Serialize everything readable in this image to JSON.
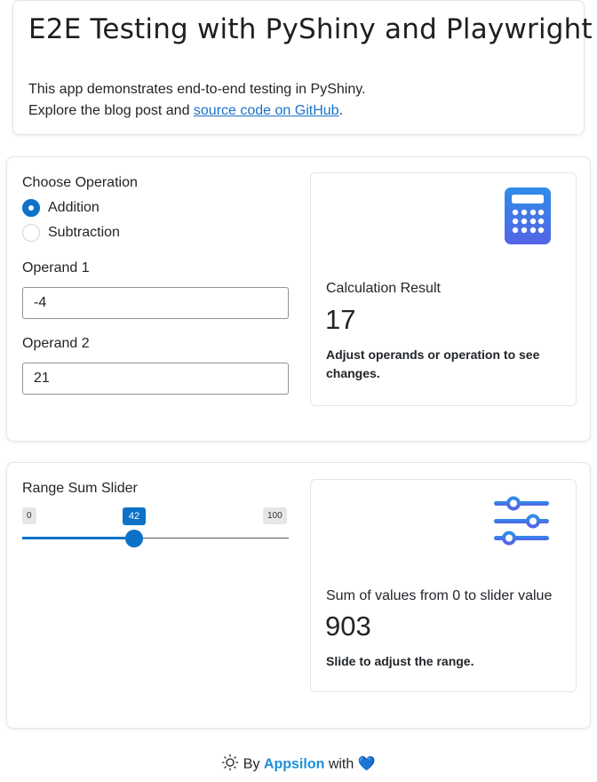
{
  "header": {
    "title": "E2E Testing with PyShiny and Playwright",
    "intro_line1": "This app demonstrates end-to-end testing in PyShiny.",
    "intro_line2_prefix": "Explore the blog post and ",
    "intro_link": "source code on GitHub",
    "intro_line2_suffix": "."
  },
  "calculator": {
    "operation_label": "Choose Operation",
    "operations": [
      {
        "label": "Addition",
        "selected": true
      },
      {
        "label": "Subtraction",
        "selected": false
      }
    ],
    "operand1_label": "Operand 1",
    "operand1_value": "-4",
    "operand2_label": "Operand 2",
    "operand2_value": "21",
    "result": {
      "title": "Calculation Result",
      "value": "17",
      "description": "Adjust operands or operation to see changes.",
      "icon": "calculator-icon",
      "icon_color": "#3b6fe0"
    }
  },
  "range": {
    "slider_label": "Range Sum Slider",
    "min": "0",
    "max": "100",
    "value": "42",
    "value_fraction": 0.42,
    "result": {
      "title": "Sum of values from 0 to slider value",
      "value": "903",
      "description": "Slide to adjust the range.",
      "icon": "sliders-icon",
      "icon_color": "#3b6fe0"
    }
  },
  "footer": {
    "icon": "sun-icon",
    "by": "By",
    "brand": "Appsilon",
    "with": "with",
    "heart": "💙"
  },
  "colors": {
    "accent": "#0b72c8",
    "link": "#1a73c8",
    "brand": "#1a8fdc"
  }
}
